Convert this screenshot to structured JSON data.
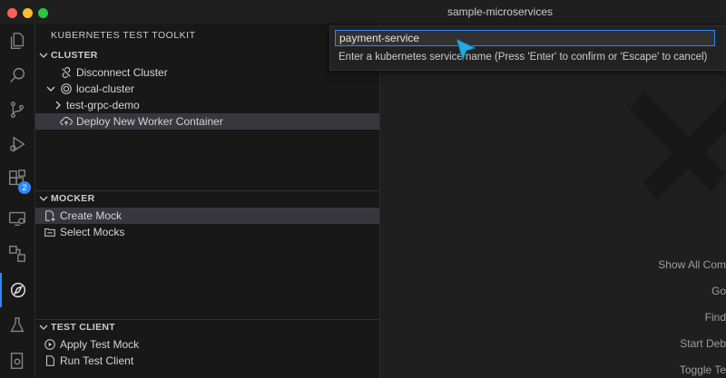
{
  "window": {
    "title": "sample-microservices"
  },
  "activity_bar": {
    "items": [
      {
        "name": "explorer-icon"
      },
      {
        "name": "search-icon"
      },
      {
        "name": "source-control-icon"
      },
      {
        "name": "run-debug-icon"
      },
      {
        "name": "extensions-icon",
        "badge": "2"
      },
      {
        "name": "remote-explorer-icon"
      },
      {
        "name": "containers-icon"
      },
      {
        "name": "kubernetes-test-toolkit-icon"
      },
      {
        "name": "testing-flask-icon"
      },
      {
        "name": "bottom-settings-icon"
      }
    ],
    "accent": "#2f87ff"
  },
  "sidebar": {
    "title": "KUBERNETES TEST TOOLKIT",
    "cluster": {
      "header": "CLUSTER",
      "items": [
        {
          "label": "Disconnect Cluster",
          "icon": "disconnect-icon"
        },
        {
          "label": "local-cluster",
          "icon": "target-icon"
        },
        {
          "label": "test-grpc-demo"
        },
        {
          "label": "Deploy New Worker Container",
          "icon": "cloud-upload-icon"
        }
      ]
    },
    "mocker": {
      "header": "MOCKER",
      "items": [
        {
          "label": "Create Mock",
          "icon": "new-file-icon"
        },
        {
          "label": "Select Mocks",
          "icon": "folder-icon"
        }
      ]
    },
    "test_client": {
      "header": "TEST CLIENT",
      "items": [
        {
          "label": "Apply Test Mock",
          "icon": "play-circle-icon"
        },
        {
          "label": "Run Test Client",
          "icon": "file-icon"
        }
      ]
    }
  },
  "quick_input": {
    "value": "payment-service",
    "message": "Enter a kubernetes service name (Press 'Enter' to confirm or 'Escape' to cancel)"
  },
  "editor": {
    "shortcuts": [
      "Show All Com",
      "Go",
      "Find",
      "Start Deb",
      "Toggle Te"
    ]
  }
}
